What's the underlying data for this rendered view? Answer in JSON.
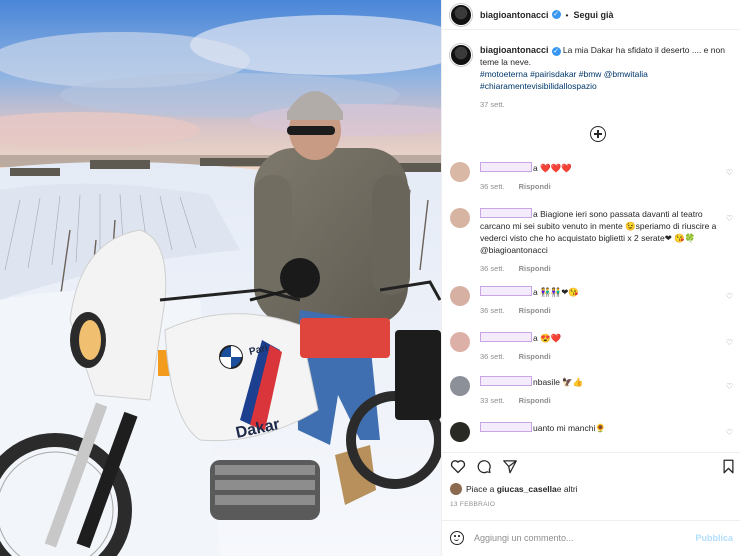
{
  "post": {
    "username": "biagioantonacci",
    "follow_separator": "•",
    "follow_label": "Segui già",
    "caption": {
      "text": "La mia Dakar ha sfidato il deserto .... e non teme la neve.",
      "hashtags": "#motoeterna #pairisdakar #bmw @bmwitalia #chiaramentevisibilidallospazio",
      "age": "37 sett."
    },
    "image": {
      "tank_brand": "Dakar",
      "tank_logo": "Pari"
    }
  },
  "comments": [
    {
      "text": "a ❤️❤️❤️",
      "age": "36 sett.",
      "reply": "Rispondi"
    },
    {
      "text": "a Biagione ieri sono passata davanti al teatro carcano mi sei subito venuto in mente 😉speriamo di riuscire a vederci visto che ho acquistato biglietti x 2 serate❤ 😘🍀 @biagioantonacci",
      "age": "36 sett.",
      "reply": "Rispondi"
    },
    {
      "text": "a 👫👫❤😘",
      "age": "36 sett.",
      "reply": "Rispondi"
    },
    {
      "text": "a 😍❤️",
      "age": "36 sett.",
      "reply": "Rispondi"
    },
    {
      "text": "nbasile 🦅👍",
      "age": "33 sett.",
      "reply": "Rispondi"
    },
    {
      "text": "uanto mi manchi🌻",
      "age": "",
      "reply": ""
    }
  ],
  "likes": {
    "prefix": "Piace a ",
    "user": "giucas_casella",
    "suffix": " e altri"
  },
  "date": "13 FEBBRAIO",
  "add_comment": {
    "placeholder": "Aggiungi un commento...",
    "publish_label": "Pubblica"
  },
  "icons": {
    "like": "heart-icon",
    "comment": "comment-icon",
    "share": "paper-plane-icon",
    "save": "bookmark-icon",
    "emoji": "smile-icon",
    "load_more": "plus-circle-icon",
    "verified": "verified-badge-icon"
  },
  "colors": {
    "link": "#00376b",
    "meta": "#8e8e8e",
    "verified": "#3897f0",
    "publish": "#b2dffc"
  }
}
